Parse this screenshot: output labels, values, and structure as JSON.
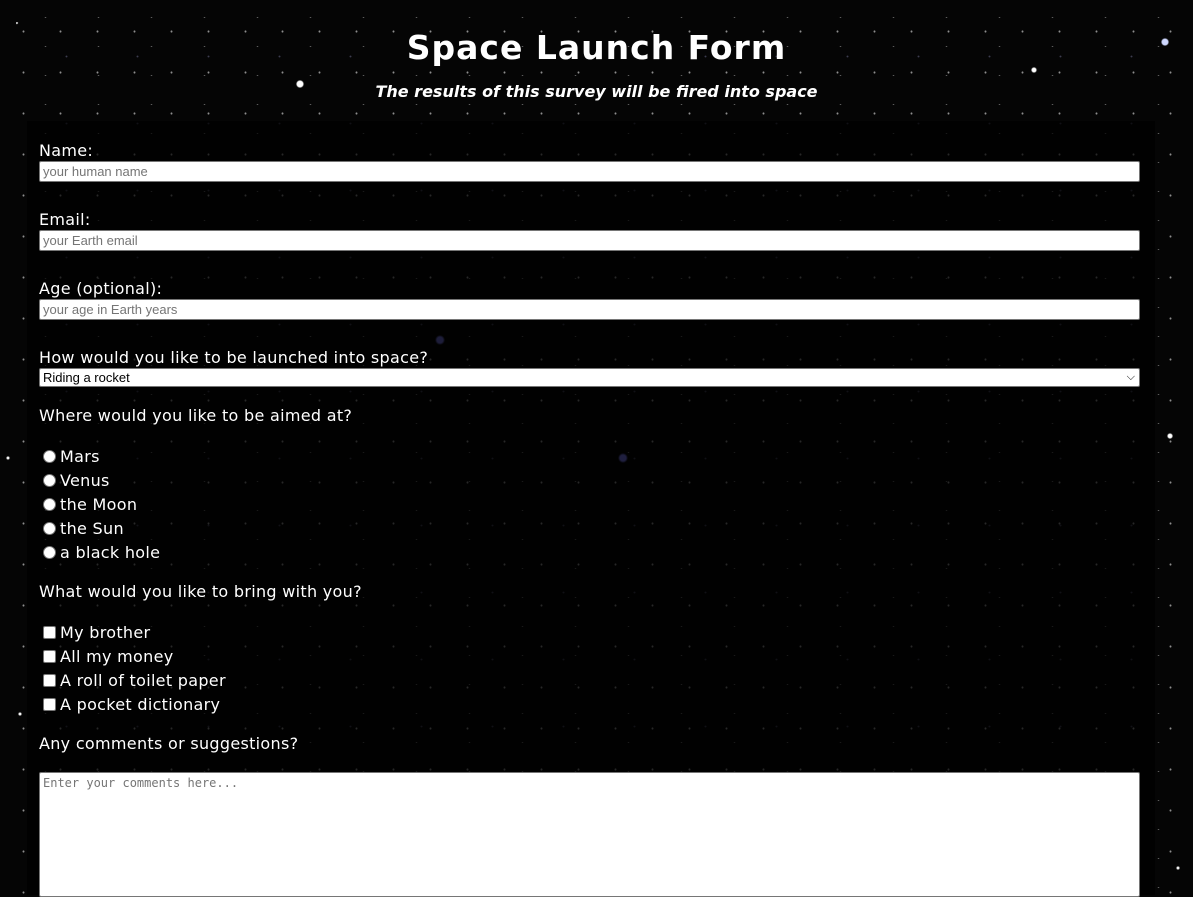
{
  "header": {
    "title": "Space Launch Form",
    "subtitle": "The results of this survey will be fired into space"
  },
  "form": {
    "name": {
      "label": "Name:",
      "placeholder": "your human name"
    },
    "email": {
      "label": "Email:",
      "placeholder": "your Earth email"
    },
    "age": {
      "label": "Age (optional):",
      "placeholder": "your age in Earth years"
    },
    "launch_method": {
      "label": "How would you like to be launched into space?",
      "selected": "Riding a rocket"
    },
    "target": {
      "label": "Where would you like to be aimed at?",
      "options": [
        "Mars",
        "Venus",
        "the Moon",
        "the Sun",
        "a black hole"
      ]
    },
    "bring": {
      "label": "What would you like to bring with you?",
      "options": [
        "My brother",
        "All my money",
        "A roll of toilet paper",
        "A pocket dictionary"
      ]
    },
    "comments": {
      "label": "Any comments or suggestions?",
      "placeholder": "Enter your comments here..."
    }
  },
  "colors": {
    "background": "#050505",
    "text": "#ffffff",
    "input_background": "#ffffff"
  }
}
